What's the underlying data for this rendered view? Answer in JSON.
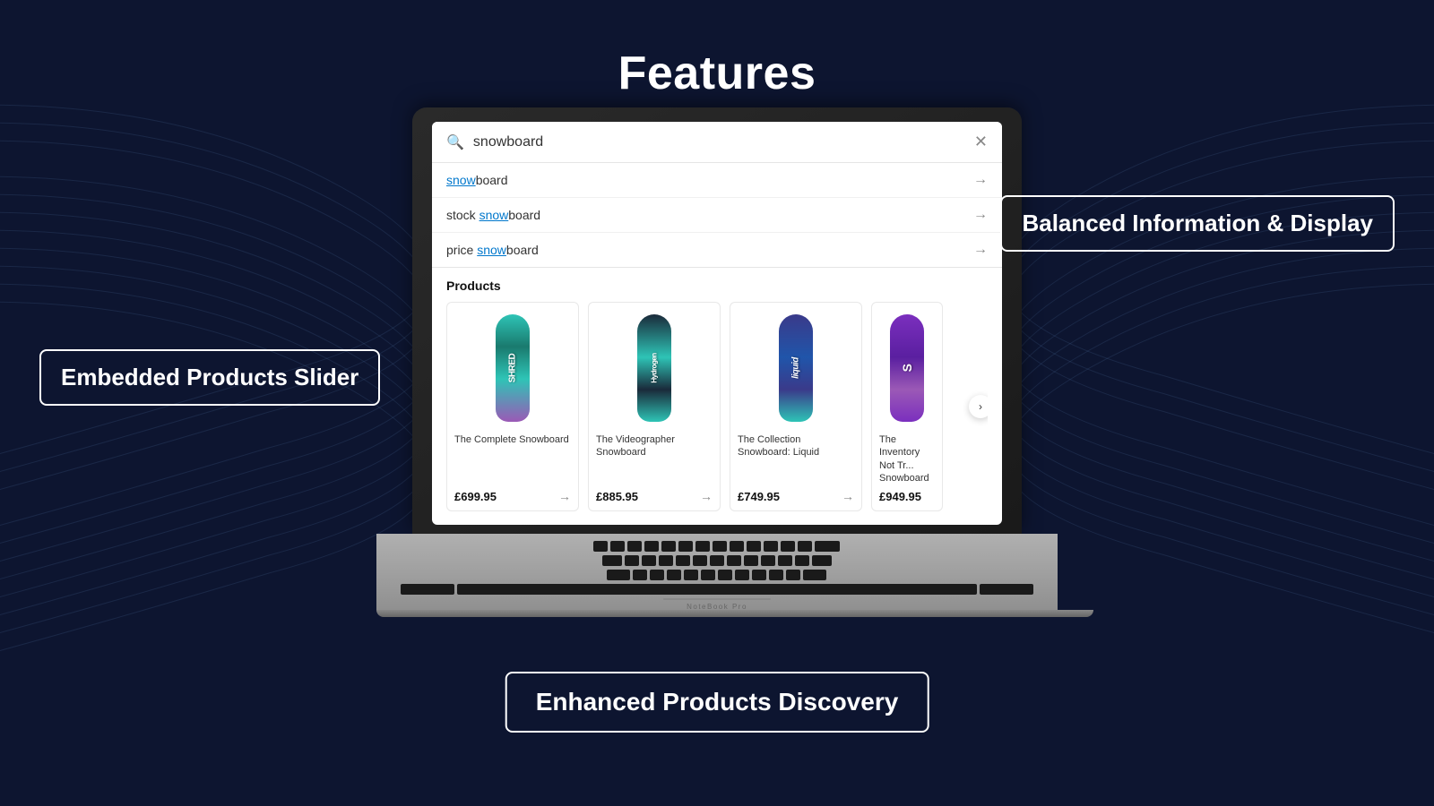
{
  "page": {
    "title": "Features",
    "background_color": "#0d1530"
  },
  "labels": {
    "embedded_slider": "Embedded Products Slider",
    "balanced_info": "Balanced Information & Display",
    "enhanced_discovery": "Enhanced Products Discovery"
  },
  "laptop": {
    "brand": "NoteBook Pro"
  },
  "search": {
    "query": "snowboard",
    "suggestions": [
      {
        "prefix": "",
        "highlight": "snow",
        "suffix": "board"
      },
      {
        "prefix": "stock ",
        "highlight": "snow",
        "suffix": "board"
      },
      {
        "prefix": "price ",
        "highlight": "snow",
        "suffix": "board"
      }
    ],
    "products_label": "Products",
    "products": [
      {
        "name": "The Complete Snowboard",
        "price": "£699.95",
        "sb_class": "sb-1",
        "sb_text": "SHRED"
      },
      {
        "name": "The Videographer Snowboard",
        "price": "£885.95",
        "sb_class": "sb-2",
        "sb_text": "Hydrogen"
      },
      {
        "name": "The Collection Snowboard: Liquid",
        "price": "£749.95",
        "sb_class": "sb-3",
        "sb_text": "liquid"
      },
      {
        "name": "The Inventory Not Tracked Snowboard",
        "price": "£949.95",
        "sb_class": "sb-4",
        "sb_text": "S"
      }
    ]
  }
}
